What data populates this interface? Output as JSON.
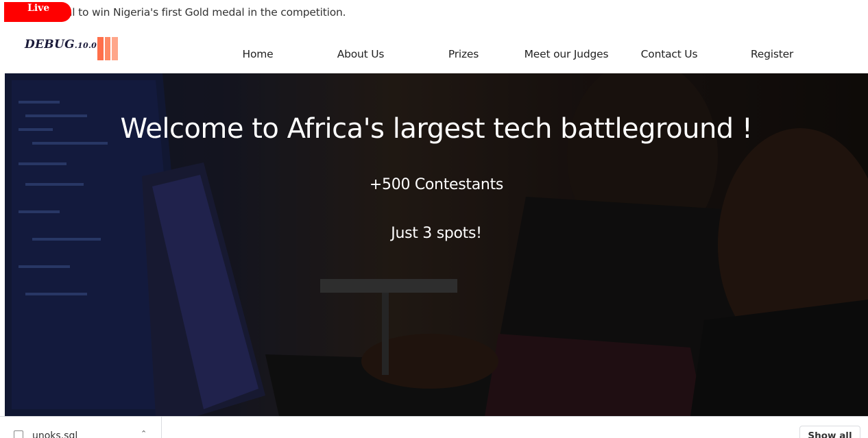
{
  "ticker": {
    "badge": "Live",
    "text": "al to win Nigeria's first Gold medal in the competition."
  },
  "header": {
    "logo_main": "DEBUG",
    "logo_version": ".10.0",
    "logo_bar_colors": [
      "#ff6f4a",
      "#ff8a65",
      "#ffa68a"
    ],
    "nav": [
      {
        "label": "Home"
      },
      {
        "label": "About Us"
      },
      {
        "label": "Prizes"
      },
      {
        "label": "Meet our Judges"
      },
      {
        "label": "Contact Us"
      },
      {
        "label": "Register"
      }
    ]
  },
  "hero": {
    "title": "Welcome to Africa's largest tech battleground !",
    "contestants": "+500 Contestants",
    "spots": "Just 3 spots!"
  },
  "downloads": {
    "file_name": "unoks.sql",
    "show_all": "Show all"
  },
  "colors": {
    "live_badge": "#ff0000",
    "accent": "#ff7a55"
  }
}
